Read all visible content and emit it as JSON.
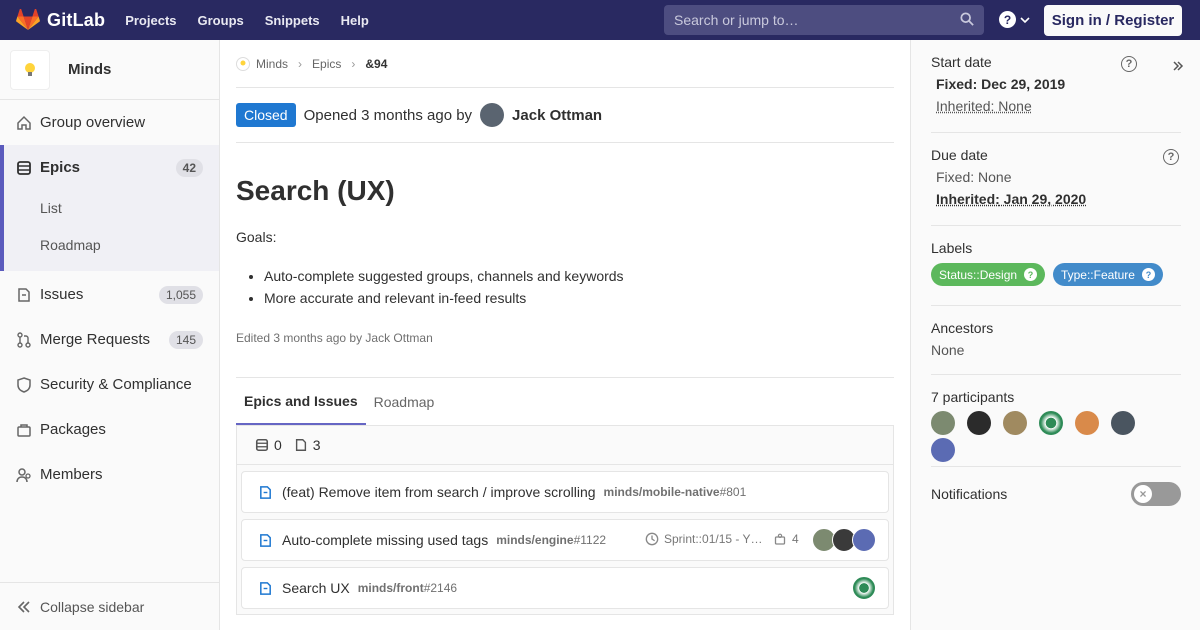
{
  "topbar": {
    "brand": "GitLab",
    "nav": [
      "Projects",
      "Groups",
      "Snippets",
      "Help"
    ],
    "search_placeholder": "Search or jump to…",
    "help_icon": "?",
    "signin": "Sign in / Register"
  },
  "sidebar": {
    "group_name": "Minds",
    "items": [
      {
        "label": "Group overview",
        "icon": "home-icon"
      },
      {
        "label": "Epics",
        "count": "42",
        "icon": "epic-icon"
      },
      {
        "label": "Issues",
        "count": "1,055",
        "icon": "issues-icon"
      },
      {
        "label": "Merge Requests",
        "count": "145",
        "icon": "merge-request-icon"
      },
      {
        "label": "Security & Compliance",
        "icon": "shield-icon"
      },
      {
        "label": "Packages",
        "icon": "package-icon"
      },
      {
        "label": "Members",
        "icon": "users-icon"
      }
    ],
    "epics_sub": [
      "List",
      "Roadmap"
    ],
    "collapse": "Collapse sidebar"
  },
  "breadcrumb": [
    "Minds",
    "Epics",
    "&94"
  ],
  "header": {
    "status": "Closed",
    "opened": "Opened 3 months ago by",
    "author": "Jack Ottman"
  },
  "epic": {
    "title": "Search (UX)",
    "goals": "Goals:",
    "bullets": [
      "Auto-complete suggested groups, channels and keywords",
      "More accurate and relevant in-feed results"
    ],
    "edited": "Edited 3 months ago by Jack Ottman"
  },
  "tabs": [
    "Epics and Issues",
    "Roadmap"
  ],
  "tree": {
    "epic_count": "0",
    "issue_count": "3",
    "rows": [
      {
        "title": "(feat) Remove item from search / improve scrolling",
        "path": "minds/mobile-native",
        "num": "#801"
      },
      {
        "title": "Auto-complete missing used tags",
        "path": "minds/engine",
        "num": "#1122",
        "milestone": "Sprint::01/15 - Y…",
        "weight": "4"
      },
      {
        "title": "Search UX",
        "path": "minds/front",
        "num": "#2146"
      }
    ]
  },
  "right": {
    "start_date": {
      "heading": "Start date",
      "fixed_label": "Fixed:",
      "fixed": "Dec 29, 2019",
      "inherited_label": "Inherited:",
      "inherited": "None"
    },
    "due_date": {
      "heading": "Due date",
      "fixed_label": "Fixed:",
      "fixed": "None",
      "inherited_label": "Inherited:",
      "inherited": "Jan 29, 2020"
    },
    "labels": {
      "heading": "Labels",
      "items": [
        {
          "text": "Status::Design",
          "color": "#5cb85c"
        },
        {
          "text": "Type::Feature",
          "color": "#428bca"
        }
      ]
    },
    "ancestors": {
      "heading": "Ancestors",
      "value": "None"
    },
    "participants": {
      "heading": "7 participants"
    },
    "notifications": {
      "heading": "Notifications"
    }
  },
  "colors": {
    "navbar": "#292961",
    "accent": "#6666c4",
    "closed": "#1f78d1"
  }
}
